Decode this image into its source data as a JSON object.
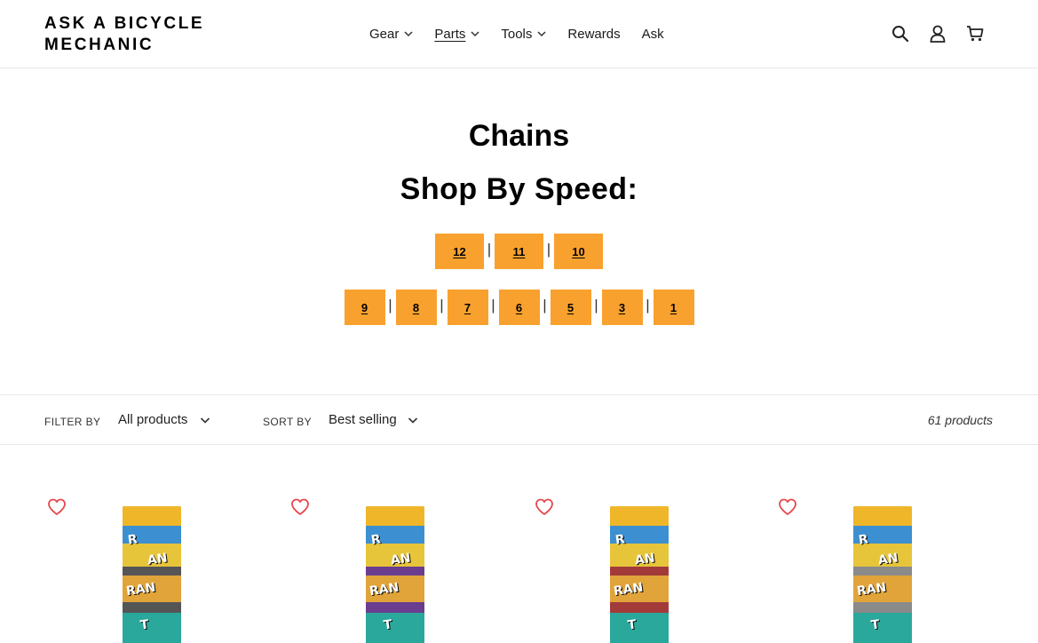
{
  "header": {
    "logo_line1": "ASK A BICYCLE",
    "logo_line2": "MECHANIC",
    "nav": [
      {
        "label": "Gear",
        "has_dropdown": true,
        "active": false
      },
      {
        "label": "Parts",
        "has_dropdown": true,
        "active": true
      },
      {
        "label": "Tools",
        "has_dropdown": true,
        "active": false
      },
      {
        "label": "Rewards",
        "has_dropdown": false,
        "active": false
      },
      {
        "label": "Ask",
        "has_dropdown": false,
        "active": false
      }
    ],
    "icons": [
      "search-icon",
      "account-icon",
      "cart-icon"
    ]
  },
  "main": {
    "title": "Chains",
    "subtitle": "Shop By Speed:",
    "speeds_row1": [
      "12",
      "11",
      "10"
    ],
    "speeds_row2": [
      "9",
      "8",
      "7",
      "6",
      "5",
      "3",
      "1"
    ],
    "separator": "|",
    "accent_color": "#f9a12e"
  },
  "filters": {
    "filter_label": "FILTER BY",
    "filter_value": "All products",
    "sort_label": "SORT BY",
    "sort_value": "Best selling",
    "product_count": "61 products"
  },
  "products": [
    {
      "image": "chain-box-image",
      "chain_color": "#555555"
    },
    {
      "image": "chain-box-image",
      "chain_color": "#6a3d8f"
    },
    {
      "image": "chain-box-image",
      "chain_color": "#a33a3a"
    },
    {
      "image": "chain-box-image",
      "chain_color": "#8a8a8a"
    }
  ],
  "colors": {
    "wishlist_heart": "#e5484d"
  }
}
